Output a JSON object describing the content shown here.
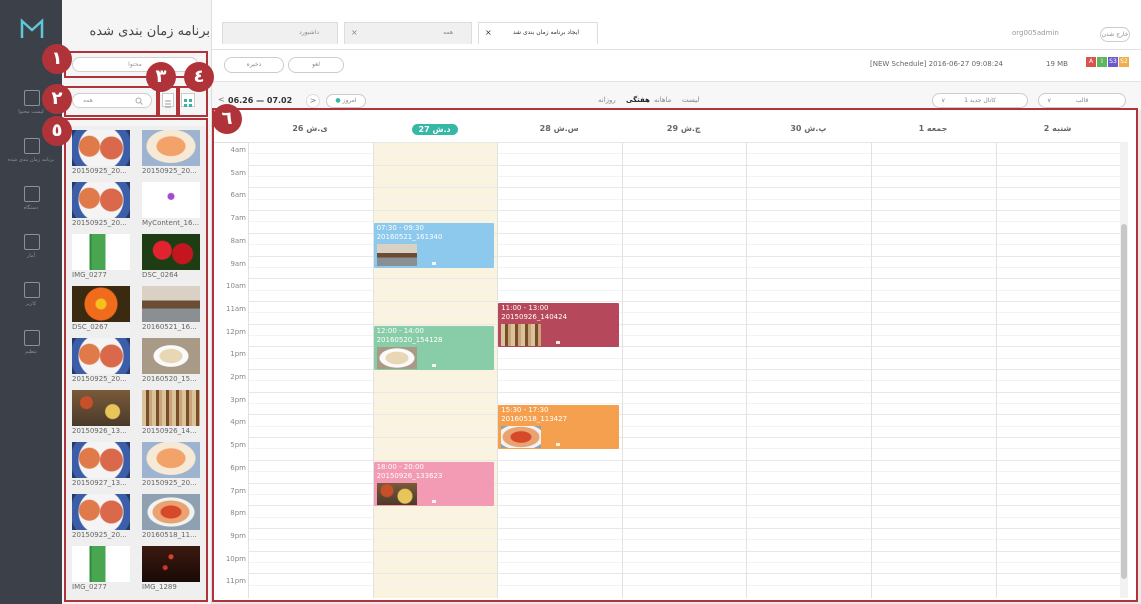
{
  "sidebar": {
    "nav": [
      {
        "label": "ليست محتوا",
        "icon": "upload-icon"
      },
      {
        "label": "برنامه زمان بندى شده",
        "icon": "calendar-icon"
      },
      {
        "label": "دستگاه",
        "icon": "monitor-icon"
      },
      {
        "label": "آمار",
        "icon": "chart-icon"
      },
      {
        "label": "کاربر",
        "icon": "user-icon"
      },
      {
        "label": "تنظیم",
        "icon": "gear-icon"
      }
    ]
  },
  "panel": {
    "title": "برنامه زمان بندى شده",
    "content_filter": "محتوا",
    "search_placeholder": "همه",
    "thumbs": [
      {
        "label": "20150925_20...",
        "img": "sushi"
      },
      {
        "label": "20150925_20...",
        "img": "salmon"
      },
      {
        "label": "20150925_20...",
        "img": "sushi"
      },
      {
        "label": "MyContent_16...",
        "img": "blank"
      },
      {
        "label": "IMG_0277",
        "img": "plant"
      },
      {
        "label": "DSC_0264",
        "img": "redflower"
      },
      {
        "label": "DSC_0267",
        "img": "orangeflower"
      },
      {
        "label": "20160521_16...",
        "img": "table"
      },
      {
        "label": "20150925_20...",
        "img": "sushi"
      },
      {
        "label": "20160520_15...",
        "img": "bowl"
      },
      {
        "label": "20150926_13...",
        "img": "tray"
      },
      {
        "label": "20150926_14...",
        "img": "market"
      },
      {
        "label": "20150927_13...",
        "img": "sushi"
      },
      {
        "label": "20150925_20...",
        "img": "salmon"
      },
      {
        "label": "20150925_20...",
        "img": "sushi"
      },
      {
        "label": "20160518_11...",
        "img": "pasta"
      },
      {
        "label": "IMG_0277",
        "img": "plant"
      },
      {
        "label": "IMG_1289",
        "img": "dark"
      }
    ]
  },
  "header": {
    "tabs": [
      {
        "label": "داشبورد",
        "icon": "dashboard-icon",
        "close": ""
      },
      {
        "label": "همه",
        "icon": "list-icon",
        "close": "×"
      },
      {
        "label": "ایجاد برنامه زمان بندی شد",
        "icon": "calendar-icon",
        "close": "×"
      }
    ],
    "user": "org005admin",
    "logout": "خارج شدن",
    "cancel_label": "لغو",
    "save_label": "ذخیره",
    "schedule_info": "[NEW Schedule] 2016-06-27 09:08:24",
    "size": "19 MB",
    "badges": [
      {
        "text": "A",
        "color": "#d9534f"
      },
      {
        "text": "I",
        "color": "#5cb85c"
      },
      {
        "text": "S3",
        "color": "#6a5acd"
      },
      {
        "text": "S2",
        "color": "#f0ad4e"
      }
    ]
  },
  "toolbar": {
    "today_label": "امروز",
    "date_range": "06.26 — 07.02",
    "prev_arrow": "<",
    "next_arrow": ">",
    "views": [
      "لیست",
      "ماهانه",
      "هفتگی",
      "روزانه"
    ],
    "active_view": "هفتگی",
    "channel_select": "کانال جدید 1",
    "template_select": "قالب"
  },
  "calendar": {
    "days": [
      "ی.ش 26",
      "د.ش 27",
      "س.ش 28",
      "چ.ش 29",
      "پ.ش 30",
      "جمعه 1",
      "شنبه 2"
    ],
    "today": "د.ش 27",
    "hours": [
      "4am",
      "5am",
      "6am",
      "7am",
      "8am",
      "9am",
      "10am",
      "11am",
      "12pm",
      "1pm",
      "2pm",
      "3pm",
      "4pm",
      "5pm",
      "6pm",
      "7pm",
      "8pm",
      "9pm",
      "10pm",
      "11pm"
    ],
    "events": [
      {
        "day": 1,
        "start": 7.5,
        "end": 9.5,
        "time": "07:30 - 09:30",
        "name": "20160521_161340",
        "color": "#8dc8ed",
        "img": "table"
      },
      {
        "day": 1,
        "start": 12,
        "end": 14,
        "time": "12:00 - 14:00",
        "name": "20160520_154128",
        "color": "#88cda8",
        "img": "bowl"
      },
      {
        "day": 1,
        "start": 18,
        "end": 20,
        "time": "18:00 - 20:00",
        "name": "20150926_133623",
        "color": "#f39ab5",
        "img": "tray"
      },
      {
        "day": 2,
        "start": 11,
        "end": 13,
        "time": "11:00 - 13:00",
        "name": "20150926_140424",
        "color": "#b5485a",
        "img": "market"
      },
      {
        "day": 2,
        "start": 15.5,
        "end": 17.5,
        "time": "15:30 - 17:30",
        "name": "20160518_113427",
        "color": "#f5a04f",
        "img": "pasta"
      }
    ]
  },
  "callouts": [
    "١",
    "٢",
    "٣",
    "٤",
    "٥",
    "٦"
  ]
}
